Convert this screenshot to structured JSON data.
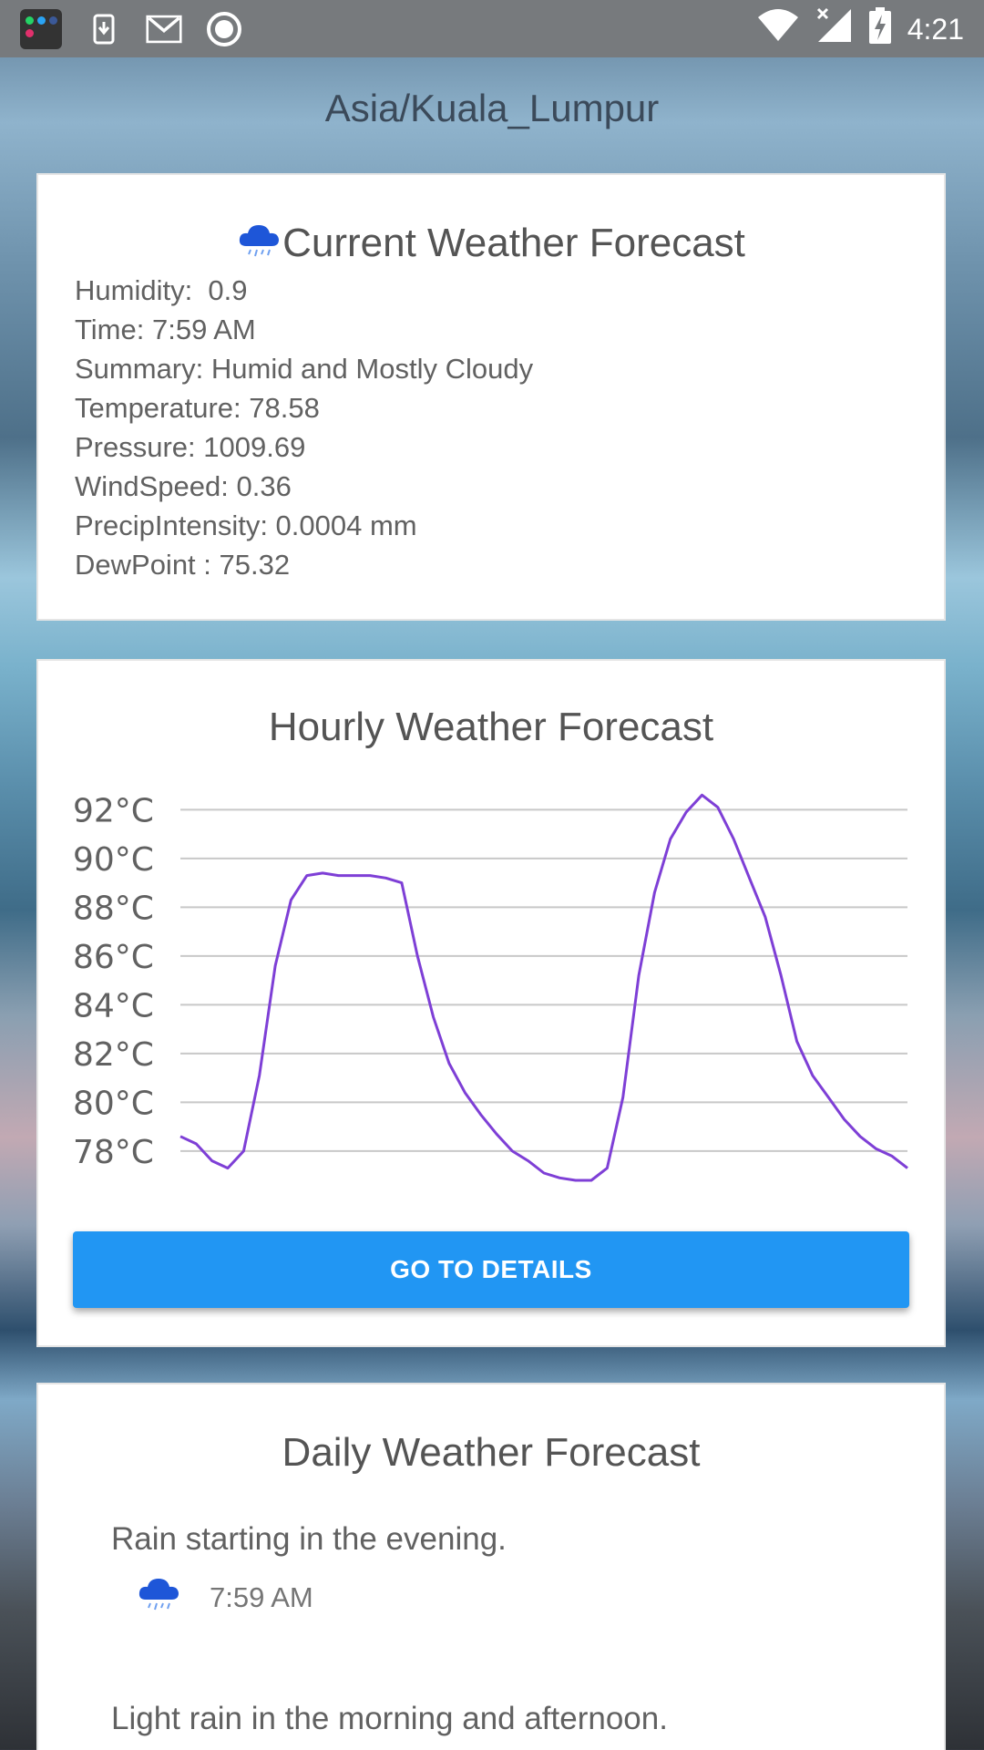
{
  "status_bar": {
    "time": "4:21",
    "icons": [
      "app-folder-icon",
      "download-icon",
      "gmail-icon",
      "record-icon",
      "wifi-icon",
      "signal-icon",
      "battery-charging-icon"
    ]
  },
  "header": {
    "title": "Asia/Kuala_Lumpur"
  },
  "current": {
    "heading": "Current Weather Forecast",
    "icon": "rain-cloud-icon",
    "fields": [
      {
        "label": "Humidity:",
        "value": "  0.9"
      },
      {
        "label": "Time:",
        "value": " 7:59 AM"
      },
      {
        "label": "Summary:",
        "value": " Humid and Mostly Cloudy"
      },
      {
        "label": "Temperature:",
        "value": " 78.58"
      },
      {
        "label": "Pressure:",
        "value": " 1009.69"
      },
      {
        "label": "WindSpeed:",
        "value": " 0.36"
      },
      {
        "label": "PrecipIntensity:",
        "value": " 0.0004 mm"
      },
      {
        "label": "DewPoint :",
        "value": " 75.32"
      }
    ]
  },
  "hourly": {
    "heading": "Hourly Weather Forecast",
    "button_label": "GO TO DETAILS"
  },
  "chart_data": {
    "type": "line",
    "title": "",
    "xlabel": "",
    "ylabel": "",
    "y_ticks": [
      "92°C",
      "90°C",
      "88°C",
      "86°C",
      "84°C",
      "82°C",
      "80°C",
      "78°C"
    ],
    "y_tick_values": [
      92,
      90,
      88,
      86,
      84,
      82,
      80,
      78
    ],
    "ylim": [
      76.8,
      92.5
    ],
    "grid": true,
    "line_color": "#7e3fd6",
    "series": [
      {
        "values": [
          78.6,
          78.3,
          77.6,
          77.3,
          78.0,
          81.1,
          85.6,
          88.3,
          89.3,
          89.4,
          89.3,
          89.3,
          89.3,
          89.2,
          89.0,
          86.0,
          83.5,
          81.6,
          80.4,
          79.5,
          78.7,
          78.0,
          77.6,
          77.1,
          76.9,
          76.8,
          76.8,
          77.3,
          80.2,
          85.2,
          88.6,
          90.8,
          91.9,
          92.6,
          92.1,
          90.8,
          89.2,
          87.6,
          85.2,
          82.5,
          81.1,
          80.2,
          79.3,
          78.6,
          78.1,
          77.8,
          77.3
        ]
      }
    ]
  },
  "daily": {
    "heading": "Daily Weather Forecast",
    "items": [
      {
        "summary": "Rain starting in the evening.",
        "time": "7:59 AM",
        "icon": "rain-cloud-icon"
      },
      {
        "summary": "Light rain in the morning and afternoon.",
        "time": "",
        "icon": "rain-cloud-icon"
      }
    ]
  }
}
